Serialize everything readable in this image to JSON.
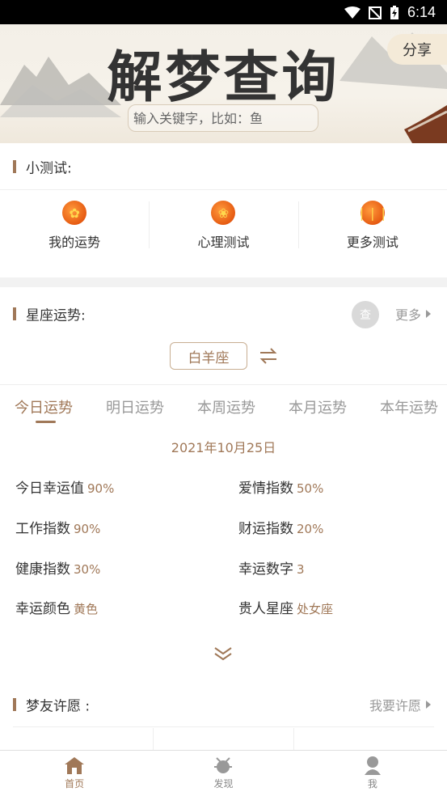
{
  "status_bar": {
    "time": "6:14"
  },
  "header": {
    "title": "解梦查询",
    "share_label": "分享",
    "search_placeholder": "输入关键字，比如：鱼"
  },
  "quiz_section": {
    "title": "小测试:",
    "items": [
      {
        "label": "我的运势",
        "icon": "lucky-knot-icon"
      },
      {
        "label": "心理测试",
        "icon": "flower-icon"
      },
      {
        "label": "更多测试",
        "icon": "fortune-sticks-icon"
      }
    ]
  },
  "horoscope_section": {
    "title": "星座运势:",
    "avatar_text": "查",
    "more_label": "更多",
    "sign": "白羊座",
    "tabs": [
      "今日运势",
      "明日运势",
      "本周运势",
      "本月运势",
      "本年运势"
    ],
    "active_tab": 0,
    "date": "2021年10月25日",
    "stats": [
      {
        "label": "今日幸运值",
        "value": "90%"
      },
      {
        "label": "爱情指数",
        "value": "50%"
      },
      {
        "label": "工作指数",
        "value": "90%"
      },
      {
        "label": "财运指数",
        "value": "20%"
      },
      {
        "label": "健康指数",
        "value": "30%"
      },
      {
        "label": "幸运数字",
        "value": "3"
      },
      {
        "label": "幸运颜色",
        "value": "黄色"
      },
      {
        "label": "贵人星座",
        "value": "处女座"
      }
    ]
  },
  "wish_section": {
    "title": "梦友许愿 :",
    "more_label": "我要许愿"
  },
  "tab_bar": {
    "items": [
      {
        "label": "首页",
        "icon": "home-icon"
      },
      {
        "label": "发现",
        "icon": "discover-icon"
      },
      {
        "label": "我",
        "icon": "profile-icon"
      }
    ],
    "active": 0
  },
  "colors": {
    "accent": "#a07858",
    "text": "#333333",
    "muted": "#999999"
  }
}
